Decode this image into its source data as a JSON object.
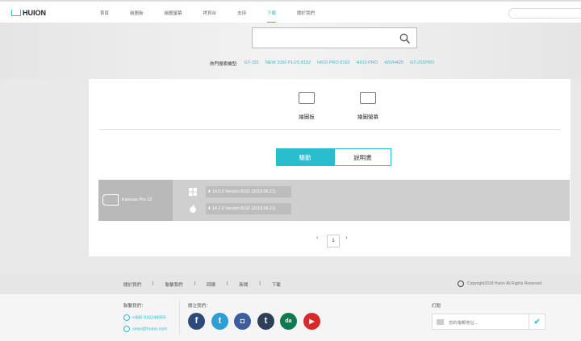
{
  "brand": "HUION",
  "nav": [
    "首頁",
    "繪圖板",
    "繪圖螢幕",
    "拷貝台",
    "支持",
    "下載",
    "關於我們"
  ],
  "hot": {
    "label": "熱門搜索機型:",
    "items": [
      "GT-191",
      "NEW 1060 PLUS 8192",
      "H610 PRO 8192",
      "H610 PRO",
      "420/H420",
      "GT-221PRO"
    ]
  },
  "categories": [
    "繪圖板",
    "繪圖螢幕"
  ],
  "tabs": [
    "驅動",
    "說明書"
  ],
  "driver": {
    "product": "Kamvas Pro 22",
    "windows": "14.5.0 Version 8192 (2018.06.21)",
    "mac": "14.2.0 Version 8192 (2018.06.21)"
  },
  "pagination": {
    "prev": "‹",
    "page": "1",
    "next": "›"
  },
  "footer": {
    "links": [
      "關於我們",
      "聯繫我們",
      "回饋",
      "新聞",
      "下載"
    ],
    "separator": "|",
    "copyright": "Copyright2018 Huion All Rights Reserved",
    "contact_label": "聯繫我們：",
    "phone": "+886 916249959",
    "email": "sean@huion.com",
    "follow_label": "關注我們：",
    "subscribe_label": "訂閱",
    "subscribe_placeholder": "您的電郵地址...",
    "check": "✔"
  },
  "social": [
    {
      "name": "facebook",
      "glyph": "f",
      "color": "#2d4a7c"
    },
    {
      "name": "twitter",
      "glyph": "t",
      "color": "#2d9fd5"
    },
    {
      "name": "instagram",
      "glyph": "◘",
      "color": "#3d5e9e"
    },
    {
      "name": "tumblr",
      "glyph": "t",
      "color": "#2e4059"
    },
    {
      "name": "deviantart",
      "glyph": "da",
      "color": "#0f7a4f"
    },
    {
      "name": "youtube",
      "glyph": "▶",
      "color": "#d62b2b"
    }
  ]
}
